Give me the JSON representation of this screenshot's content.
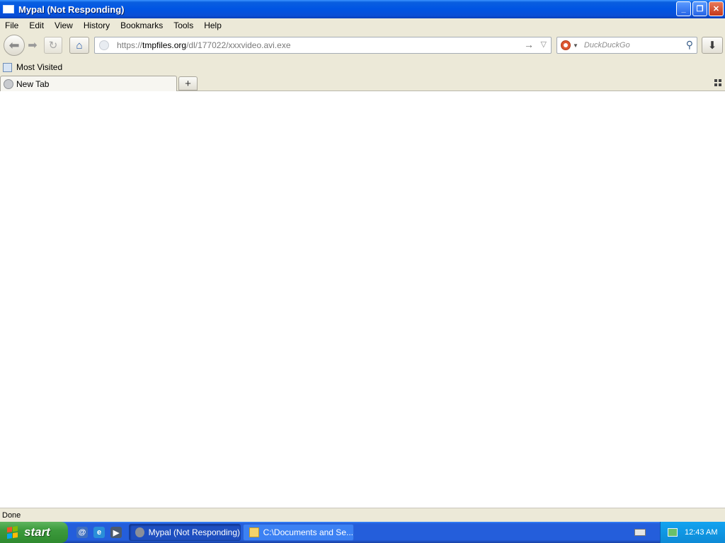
{
  "window": {
    "title": "Mypal (Not Responding)"
  },
  "menu": [
    "File",
    "Edit",
    "View",
    "History",
    "Bookmarks",
    "Tools",
    "Help"
  ],
  "toolbar": {
    "url_scheme": "https://",
    "url_domain": "tmpfiles.org",
    "url_path": "/dl/177022/xxxvideo.avi.exe",
    "search_placeholder": "DuckDuckGo"
  },
  "bookmarks": {
    "most_visited": "Most Visited"
  },
  "tabs": [
    {
      "label": "New Tab"
    }
  ],
  "status": "Done",
  "taskbar": {
    "start": "start",
    "tasks": [
      {
        "label": "Mypal (Not Responding)"
      },
      {
        "label": "C:\\Documents and Se..."
      }
    ],
    "clock": "12:43 AM"
  }
}
